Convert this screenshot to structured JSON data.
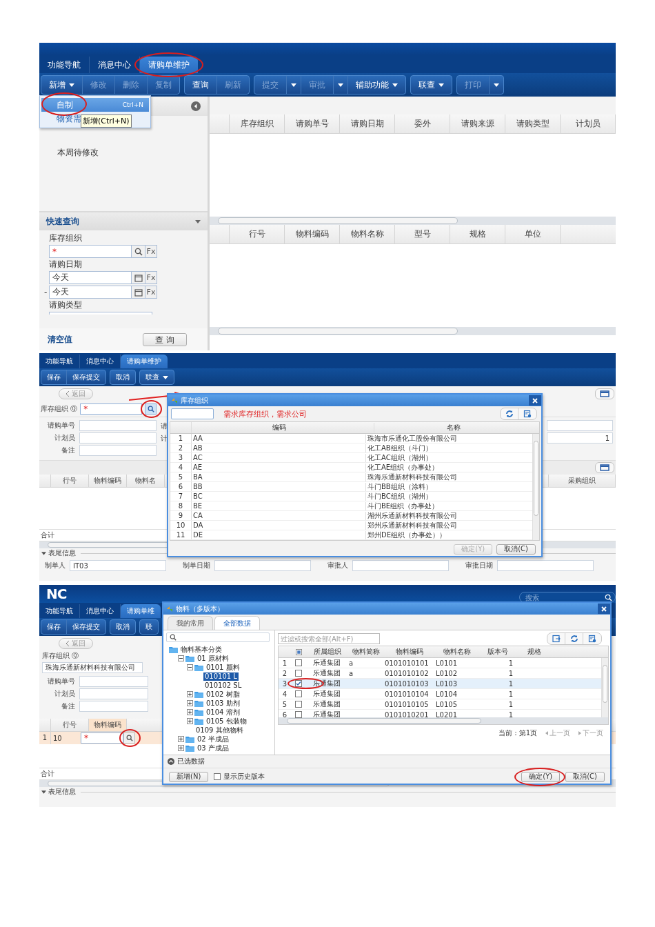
{
  "list_screen": {
    "tabs": [
      {
        "label": "功能导航",
        "selected": false,
        "circled": false
      },
      {
        "label": "消息中心",
        "selected": false,
        "circled": false
      },
      {
        "label": "请购单维护",
        "selected": true,
        "circled": true
      }
    ],
    "toolbar": [
      {
        "buttons": [
          {
            "label": "新增",
            "kind": "menu",
            "disabled": false
          },
          {
            "label": "修改",
            "kind": "plain",
            "disabled": true
          },
          {
            "label": "删除",
            "kind": "plain",
            "disabled": true
          },
          {
            "label": "复制",
            "kind": "plain",
            "disabled": true
          }
        ]
      },
      {
        "buttons": [
          {
            "label": "查询",
            "kind": "plain",
            "disabled": false
          },
          {
            "label": "刷新",
            "kind": "plain",
            "disabled": true
          }
        ]
      },
      {
        "buttons": [
          {
            "label": "提交",
            "kind": "split",
            "disabled": true
          },
          {
            "label": "审批",
            "kind": "split",
            "disabled": true
          },
          {
            "label": "辅助功能",
            "kind": "menu",
            "disabled": false
          }
        ]
      },
      {
        "buttons": [
          {
            "label": "联查",
            "kind": "menu",
            "disabled": false
          }
        ]
      },
      {
        "buttons": [
          {
            "label": "打印",
            "kind": "split",
            "disabled": true
          }
        ]
      }
    ],
    "menu": [
      {
        "label": "自制",
        "shortcut": "Ctrl+N",
        "selected": true,
        "circled": true
      },
      {
        "label": "物资需",
        "selected": false,
        "circled": false
      }
    ],
    "tooltip": "新增(Ctrl+N)",
    "left_list": [
      {
        "label": "本周待修改",
        "selected": false
      }
    ],
    "quick_query": {
      "title": "快速查询",
      "fields": [
        {
          "label": "库存组织",
          "kind": "ref",
          "required_mark": "*",
          "fx": "Fx"
        },
        {
          "label": "请购日期",
          "kind": "date",
          "value": "今天",
          "fx": "Fx"
        },
        {
          "prefix": "-",
          "kind": "date",
          "value": "今天",
          "fx": "Fx"
        },
        {
          "label": "请购类型",
          "kind": "cut"
        }
      ],
      "clear_label": "清空值",
      "query_label": "查 询"
    },
    "header_grid": {
      "columns": [
        "库存组织",
        "请购单号",
        "请购日期",
        "委外",
        "请购来源",
        "请购类型",
        "计划员"
      ]
    },
    "detail_grid": {
      "columns": [
        "行号",
        "物料编码",
        "物料名称",
        "型号",
        "规格",
        "单位"
      ]
    }
  },
  "form_screen": {
    "tabs": [
      {
        "label": "功能导航",
        "selected": false
      },
      {
        "label": "消息中心",
        "selected": false
      },
      {
        "label": "请购单维护",
        "selected": true
      }
    ],
    "toolbar": [
      {
        "buttons": [
          {
            "label": "保存",
            "kind": "plain",
            "disabled": false
          },
          {
            "label": "保存提交",
            "kind": "plain",
            "disabled": false
          }
        ]
      },
      {
        "buttons": [
          {
            "label": "取消",
            "kind": "plain",
            "disabled": false
          }
        ]
      },
      {
        "buttons": [
          {
            "label": "联查",
            "kind": "menu",
            "disabled": false
          }
        ]
      }
    ],
    "back_label": "返回",
    "org_field": {
      "label": "库存组织",
      "shortcut": "Ⓠ",
      "required_mark": "*",
      "circled": true
    },
    "fields": [
      {
        "label": "请购单号"
      },
      {
        "label": "计划员"
      },
      {
        "label": "备注"
      }
    ],
    "side_labels": [
      "请",
      "计"
    ],
    "side_value": "1",
    "grid": {
      "columns": [
        "行号",
        "物料编码",
        "物料名"
      ],
      "right_column": "采购组织",
      "total_label": "合计"
    },
    "footer": {
      "title": "表尾信息",
      "fields": [
        {
          "label": "制单人",
          "value": "IT03"
        },
        {
          "label": "制单日期"
        },
        {
          "label": "审批人"
        },
        {
          "label": "审批日期"
        }
      ]
    },
    "dialog": {
      "title": "库存组织",
      "note": "需求库存组织，需求公司",
      "arrow": true,
      "columns": [
        "编码",
        "名称"
      ],
      "rows": [
        {
          "no": "1",
          "code": "AA",
          "name": "珠海市乐通化工股份有限公司"
        },
        {
          "no": "2",
          "code": "AB",
          "name": "化工AB组织（斗门）"
        },
        {
          "no": "3",
          "code": "AC",
          "name": "化工AC组织（湖州）"
        },
        {
          "no": "4",
          "code": "AE",
          "name": "化工AE组织（办事处）"
        },
        {
          "no": "5",
          "code": "BA",
          "name": "珠海乐通新材料科技有限公司"
        },
        {
          "no": "6",
          "code": "BB",
          "name": "斗门BB组织（涂料）"
        },
        {
          "no": "7",
          "code": "BC",
          "name": "斗门BC组织（湖州）"
        },
        {
          "no": "8",
          "code": "BE",
          "name": "斗门BE组织（办事处）"
        },
        {
          "no": "9",
          "code": "CA",
          "name": "湖州乐通新材料科技有限公司"
        },
        {
          "no": "10",
          "code": "DA",
          "name": "郑州乐通新材料科技有限公司"
        },
        {
          "no": "11",
          "code": "DE",
          "name": "郑州DE组织（办事处））"
        }
      ],
      "ok": {
        "label": "确定(Y)",
        "disabled": true
      },
      "cancel": {
        "label": "取消(C)",
        "disabled": false
      }
    }
  },
  "material_screen": {
    "logo": "NC",
    "search_placeholder": "搜索",
    "tabs": [
      {
        "label": "功能导航",
        "selected": false
      },
      {
        "label": "消息中心",
        "selected": false
      },
      {
        "label": "请购单维",
        "selected": true
      }
    ],
    "toolbar": [
      {
        "buttons": [
          {
            "label": "保存",
            "disabled": false
          },
          {
            "label": "保存提交",
            "disabled": false
          }
        ]
      },
      {
        "buttons": [
          {
            "label": "取消",
            "disabled": false
          }
        ]
      },
      {
        "buttons": [
          {
            "label": "联",
            "disabled": false
          }
        ]
      }
    ],
    "back_label": "返回",
    "org_field": {
      "label": "库存组织",
      "shortcut": "Ⓠ",
      "value": "珠海乐通新材料科技有限公司"
    },
    "fields": [
      {
        "label": "请购单号"
      },
      {
        "label": "计划员"
      },
      {
        "label": "备注"
      }
    ],
    "grid": {
      "columns": [
        "行号",
        "物料编码"
      ],
      "rows": [
        {
          "no": "1",
          "line": "10",
          "required_mark": "*",
          "circled": true
        }
      ],
      "total_label": "合计",
      "footer_title": "表尾信息"
    },
    "dialog": {
      "title": "物料（多版本）",
      "tabs": [
        {
          "label": "我的常用",
          "selected": false
        },
        {
          "label": "全部数据",
          "selected": true
        }
      ],
      "tree": [
        {
          "label": "物料基本分类",
          "kind": "folder",
          "selected": false,
          "children": [
            {
              "label": "01 原材料",
              "kind": "folder",
              "expanded": true,
              "selected": false,
              "children": [
                {
                  "label": "0101 颜料",
                  "kind": "folder",
                  "expanded": true,
                  "selected": false,
                  "children": [
                    {
                      "label": "010101 L",
                      "selected": true
                    },
                    {
                      "label": "010102 SL",
                      "selected": false
                    }
                  ]
                },
                {
                  "label": "0102 树脂",
                  "kind": "folder",
                  "expanded": false,
                  "selected": false
                },
                {
                  "label": "0103 助剂",
                  "kind": "folder",
                  "expanded": false,
                  "selected": false
                },
                {
                  "label": "0104 溶剂",
                  "kind": "folder",
                  "expanded": false,
                  "selected": false
                },
                {
                  "label": "0105 包装物",
                  "kind": "folder",
                  "expanded": false,
                  "selected": false
                },
                {
                  "label": "0109 其他物料",
                  "selected": false
                }
              ]
            },
            {
              "label": "02 半成品",
              "kind": "folder",
              "expanded": false,
              "selected": false
            },
            {
              "label": "03 产成品",
              "kind": "folder",
              "expanded": false,
              "selected": false
            }
          ]
        }
      ],
      "filter_placeholder": "过滤或搜索全部(Alt+F)",
      "partial_selection": true,
      "columns": [
        "所属组织",
        "物料简称",
        "物料编码",
        "物料名称",
        "版本号",
        "规格"
      ],
      "rows": [
        {
          "no": "1",
          "selected": false,
          "checked": false,
          "circled": false,
          "org": "乐通集团",
          "short": "a",
          "code": "0101010101",
          "name": "L0101",
          "version": "1"
        },
        {
          "no": "2",
          "selected": false,
          "checked": false,
          "circled": false,
          "org": "乐通集团",
          "short": "a",
          "code": "0101010102",
          "name": "L0102",
          "version": "1"
        },
        {
          "no": "3",
          "selected": true,
          "checked": true,
          "circled": true,
          "org": "乐通集团",
          "code": "0101010103",
          "name": "L0103",
          "version": "1"
        },
        {
          "no": "4",
          "selected": false,
          "checked": false,
          "circled": false,
          "org": "乐通集团",
          "code": "0101010104",
          "name": "L0104",
          "version": "1"
        },
        {
          "no": "5",
          "selected": false,
          "checked": false,
          "circled": false,
          "org": "乐通集团",
          "code": "0101010105",
          "name": "L0105",
          "version": "1"
        },
        {
          "no": "6",
          "selected": false,
          "checked": false,
          "circled": false,
          "org": "乐通集团",
          "code": "0101010201",
          "name": "L0201",
          "version": "1"
        }
      ],
      "pager": {
        "current": "当前：第1页",
        "prev": "上一页",
        "next": "下一页"
      },
      "selected_section": "已选数据",
      "new_label": "新增(N)",
      "history": {
        "label": "显示历史版本",
        "checked": false
      },
      "ok": {
        "label": "确定(Y)",
        "circled": true
      },
      "cancel": {
        "label": "取消(C)"
      }
    }
  }
}
